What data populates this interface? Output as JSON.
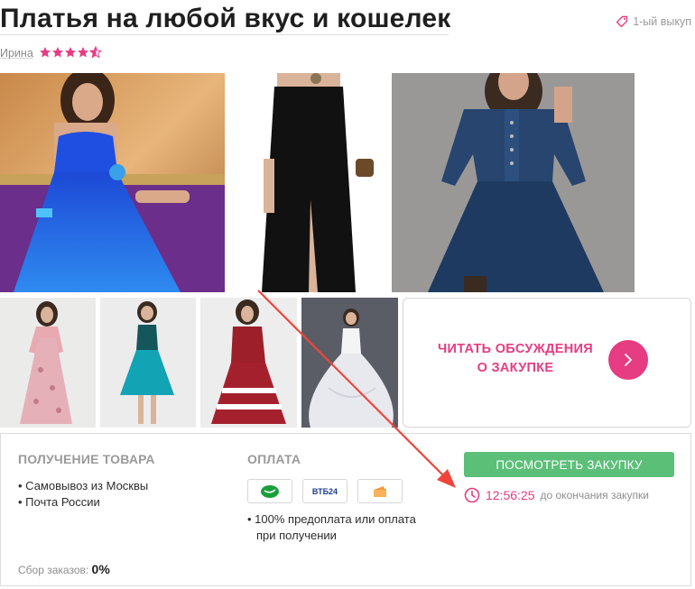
{
  "header": {
    "title": "Платья на любой вкус и кошелек",
    "badge": "1-ый выкуп",
    "author": "Ирина",
    "rating_stars": 4.5
  },
  "gallery": {
    "images": [
      {
        "name": "dress-blue-photo",
        "icon": "blue-pleated-dress"
      },
      {
        "name": "dress-black-photo",
        "icon": "black-long-dress"
      },
      {
        "name": "dress-denim-photo",
        "icon": "denim-dress"
      },
      {
        "name": "dress-floral-photo",
        "icon": "floral-maxi-dress"
      },
      {
        "name": "dress-teal-photo",
        "icon": "teal-midi-dress"
      },
      {
        "name": "dress-red-photo",
        "icon": "red-striped-dress"
      },
      {
        "name": "dress-wedding-photo",
        "icon": "white-ball-gown"
      }
    ]
  },
  "discussion": {
    "label_line1": "ЧИТАТЬ ОБСУЖДЕНИЯ",
    "label_line2": "О ЗАКУПКЕ",
    "icon": "chevron-right-icon"
  },
  "delivery": {
    "heading": "ПОЛУЧЕНИЕ ТОВАРА",
    "items": [
      "Самовывоз из Москвы",
      "Почта России"
    ]
  },
  "payment": {
    "heading": "ОПЛАТА",
    "methods": [
      {
        "name": "sberbank-icon",
        "label": ""
      },
      {
        "name": "vtb24-icon",
        "label": "ВТБ24"
      },
      {
        "name": "wallet-icon",
        "label": ""
      }
    ],
    "note_line1": "100% предоплата или оплата",
    "note_line2": "при получении"
  },
  "purchase": {
    "view_button": "ПОСМОТРЕТЬ ЗАКУПКУ",
    "timer": "12:56:25",
    "timer_label": "до окончания закупки"
  },
  "collection": {
    "label": "Сбор заказов:",
    "value": "0%"
  },
  "colors": {
    "accent_pink": "#e63c82",
    "button_green": "#5bbf78",
    "annotation_arrow": "#f0443a"
  }
}
